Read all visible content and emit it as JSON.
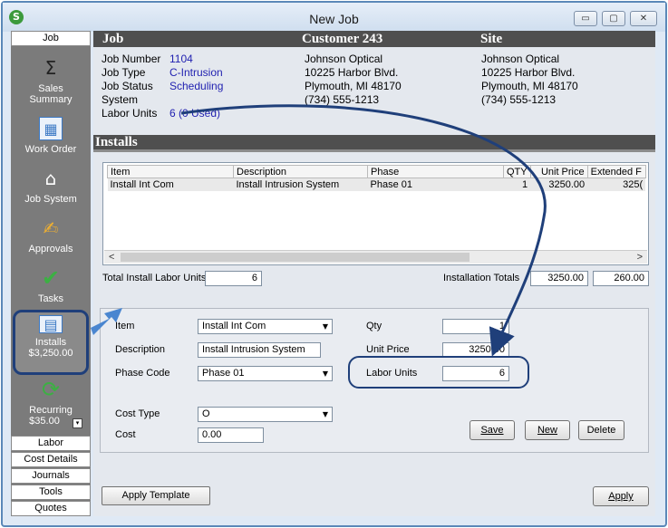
{
  "window": {
    "title": "New Job",
    "app_icon": "S",
    "min_glyph": "▭",
    "max_glyph": "▢",
    "close_glyph": "✕"
  },
  "nav": {
    "top_tab": "Job",
    "items": {
      "sales_summary": {
        "label": "Sales Summary",
        "icon": "sigma-icon",
        "glyph": "Σ"
      },
      "work_order": {
        "label": "Work Order",
        "icon": "work-order-icon",
        "glyph": "▦"
      },
      "job_system": {
        "label": "Job System",
        "icon": "job-system-icon",
        "glyph": "⌂"
      },
      "approvals": {
        "label": "Approvals",
        "icon": "approvals-icon",
        "glyph": "✍"
      },
      "tasks": {
        "label": "Tasks",
        "icon": "checkmark-icon",
        "glyph": "✔"
      },
      "installs": {
        "label": "Installs",
        "amount": "$3,250.00",
        "icon": "installs-icon",
        "glyph": "▤"
      },
      "recurring": {
        "label": "Recurring",
        "amount": "$35.00",
        "icon": "recurring-icon",
        "glyph": "⟳",
        "dropdown_glyph": "▾"
      }
    },
    "tabs": [
      "Labor",
      "Cost Details",
      "Journals",
      "Tools",
      "Quotes"
    ]
  },
  "header": {
    "job_heading": "Job",
    "customer_heading": "Customer 243",
    "site_heading": "Site"
  },
  "job": {
    "number_label": "Job Number",
    "number": "1104",
    "type_label": "Job Type",
    "type": "C-Intrusion",
    "status_label": "Job Status",
    "status": "Scheduling",
    "system_label": "System",
    "system": "",
    "labor_label": "Labor Units",
    "labor": "6 (0 Used)"
  },
  "customer": {
    "name": "Johnson Optical",
    "street": "10225 Harbor Blvd.",
    "city": "Plymouth, MI 48170",
    "phone": "(734) 555-1213"
  },
  "site": {
    "name": "Johnson Optical",
    "street": "10225 Harbor Blvd.",
    "city": "Plymouth, MI 48170",
    "phone": "(734) 555-1213"
  },
  "installs": {
    "section_title": "Installs",
    "columns": [
      "Item",
      "Description",
      "Phase",
      "QTY",
      "Unit Price",
      "Extended F"
    ],
    "rows": [
      [
        "Install Int Com",
        "Install Intrusion System",
        "Phase 01",
        "1",
        "3250.00",
        "325("
      ]
    ],
    "scroll_left": "<",
    "scroll_right": ">",
    "total_labor_label": "Total Install Labor Units",
    "total_labor_value": "6",
    "installation_totals_label": "Installation Totals",
    "total_price": "3250.00",
    "total_other": "260.00"
  },
  "form": {
    "item_label": "Item",
    "item_value": "Install Int Com",
    "description_label": "Description",
    "description_value": "Install Intrusion System",
    "phase_label": "Phase Code",
    "phase_value": "Phase 01",
    "qty_label": "Qty",
    "qty_value": "1",
    "unit_price_label": "Unit Price",
    "unit_price_value": "3250.00",
    "labor_units_label": "Labor Units",
    "labor_units_value": "6",
    "cost_type_label": "Cost Type",
    "cost_type_value": "O",
    "cost_label": "Cost",
    "cost_value": "0.00",
    "dropdown_glyph": "▼",
    "save_label": "Save",
    "new_label": "New",
    "delete_label": "Delete"
  },
  "footer": {
    "apply_template_label": "Apply Template",
    "apply_label": "Apply"
  },
  "colors": {
    "accent": "#1f3f7a",
    "arrow_blue": "#4a86d0",
    "header_dark": "#4f4f4f",
    "link_blue": "#1f1fb0"
  }
}
